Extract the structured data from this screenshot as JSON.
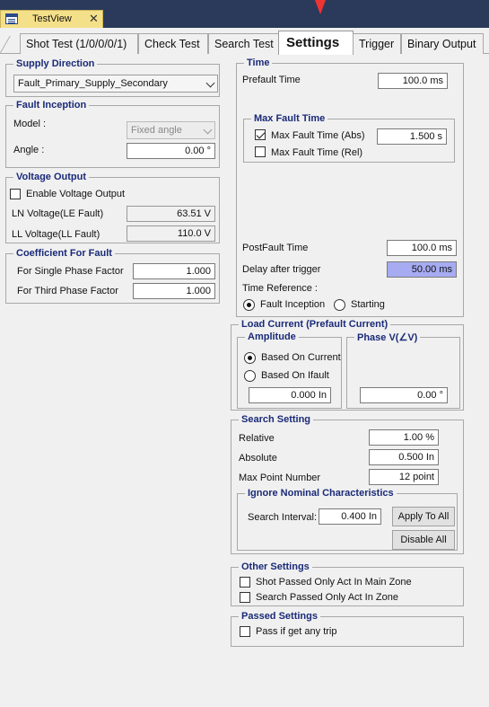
{
  "window": {
    "doc_tab_title": "TestView",
    "close_glyph": "✕"
  },
  "tabs": [
    {
      "label": "Shot Test (1/0/0/0/1)"
    },
    {
      "label": "Check Test"
    },
    {
      "label": "Search Test"
    },
    {
      "label": "Settings"
    },
    {
      "label": "Trigger"
    },
    {
      "label": "Binary Output"
    }
  ],
  "supply_direction": {
    "title": "Supply Direction",
    "selected": "Fault_Primary_Supply_Secondary"
  },
  "fault_inception": {
    "title": "Fault Inception",
    "model_label": "Model :",
    "model_value": "Fixed angle",
    "angle_label": "Angle :",
    "angle_value": "0.00 °"
  },
  "voltage_output": {
    "title": "Voltage Output",
    "enable_label": "Enable Voltage Output",
    "ln_label": "LN Voltage(LE Fault)",
    "ln_value": "63.51 V",
    "ll_label": "LL Voltage(LL Fault)",
    "ll_value": "110.0 V"
  },
  "coefficient": {
    "title": "Coefficient For Fault",
    "single_label": "For Single Phase Factor",
    "single_value": "1.000",
    "third_label": "For Third Phase Factor",
    "third_value": "1.000"
  },
  "time": {
    "title": "Time",
    "prefault_label": "Prefault Time",
    "prefault_value": "100.0 ms",
    "max_fault_title": "Max Fault Time",
    "max_abs_label": "Max Fault Time (Abs)",
    "max_abs_value": "1.500 s",
    "max_rel_label": "Max Fault Time (Rel)",
    "postfault_label": "PostFault Time",
    "postfault_value": "100.0 ms",
    "delay_label": "Delay after trigger",
    "delay_value": "50.00 ms",
    "ref_label": "Time Reference :",
    "ref_opt1": "Fault Inception",
    "ref_opt2": "Starting"
  },
  "load_current": {
    "title": "Load Current (Prefault Current)",
    "amplitude_title": "Amplitude",
    "opt_current": "Based On Current",
    "opt_ifault": "Based On Ifault",
    "amplitude_value": "0.000 In",
    "phase_title": "Phase V(∠V)",
    "phase_value": "0.00 °"
  },
  "search_setting": {
    "title": "Search Setting",
    "relative_label": "Relative",
    "relative_value": "1.00 %",
    "absolute_label": "Absolute",
    "absolute_value": "0.500 In",
    "maxpoint_label": "Max Point Number",
    "maxpoint_value": "12 point",
    "ignore_title": "Ignore Nominal Characteristics",
    "interval_label": "Search Interval:",
    "interval_value": "0.400 In",
    "apply_btn": "Apply To All",
    "disable_btn": "Disable All"
  },
  "other_settings": {
    "title": "Other Settings",
    "opt1": "Shot Passed Only Act In Main Zone",
    "opt2": "Search Passed Only Act In Zone"
  },
  "passed_settings": {
    "title": "Passed Settings",
    "opt1": "Pass if get any trip"
  }
}
